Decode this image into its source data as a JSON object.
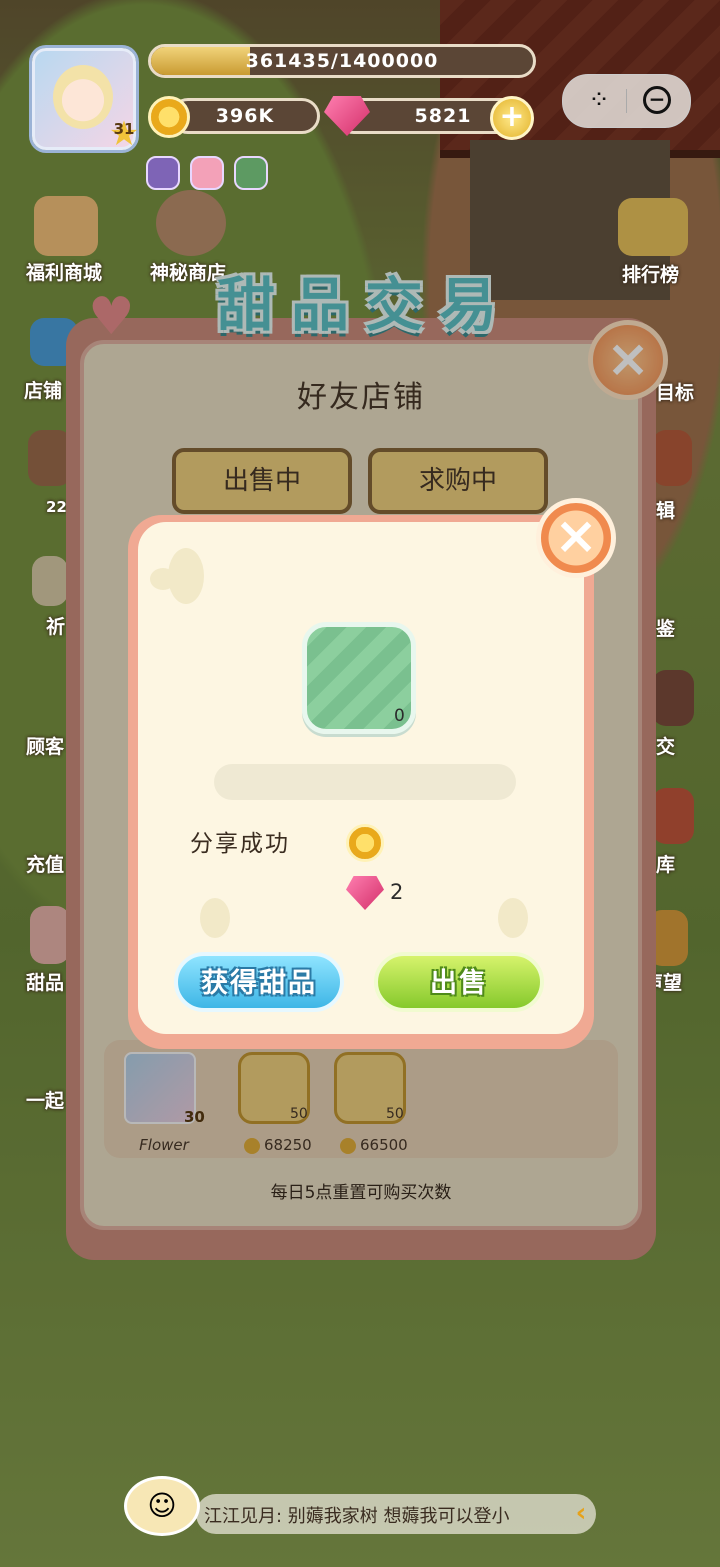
{
  "hud": {
    "level": "31",
    "xp_text": "361435/1400000",
    "xp_progress": 0.258,
    "coins": "396K",
    "gems": "5821"
  },
  "side_left": [
    {
      "label": "福利商城"
    },
    {
      "label": "神秘商店"
    },
    {
      "label": "店铺"
    },
    {
      "label": "22"
    },
    {
      "label": "祈"
    },
    {
      "label": "顾客"
    },
    {
      "label": "充值"
    },
    {
      "label": "甜品"
    },
    {
      "label": "一起"
    }
  ],
  "side_right": [
    {
      "label": "排行榜"
    },
    {
      "label": "目标"
    },
    {
      "label": "辑"
    },
    {
      "label": "鉴"
    },
    {
      "label": "交"
    },
    {
      "label": "库"
    },
    {
      "label": "声望"
    }
  ],
  "panel": {
    "title": "甜品交易",
    "subtitle": "好友店铺",
    "tabs": [
      "出售中",
      "求购中"
    ],
    "row": {
      "seller_level": "30",
      "seller_name": "Flower",
      "items": [
        {
          "qty": "50",
          "price": "68250"
        },
        {
          "qty": "50",
          "price": "66500"
        }
      ]
    },
    "footer": "每日5点重置可购买次数"
  },
  "dialog": {
    "item_qty": "0",
    "share_label": "分享成功",
    "gem_reward": "2",
    "get_button": "获得甜品",
    "sell_button": "出售"
  },
  "chat": {
    "text": "江江见月: 别薅我家树 想薅我可以登小"
  }
}
